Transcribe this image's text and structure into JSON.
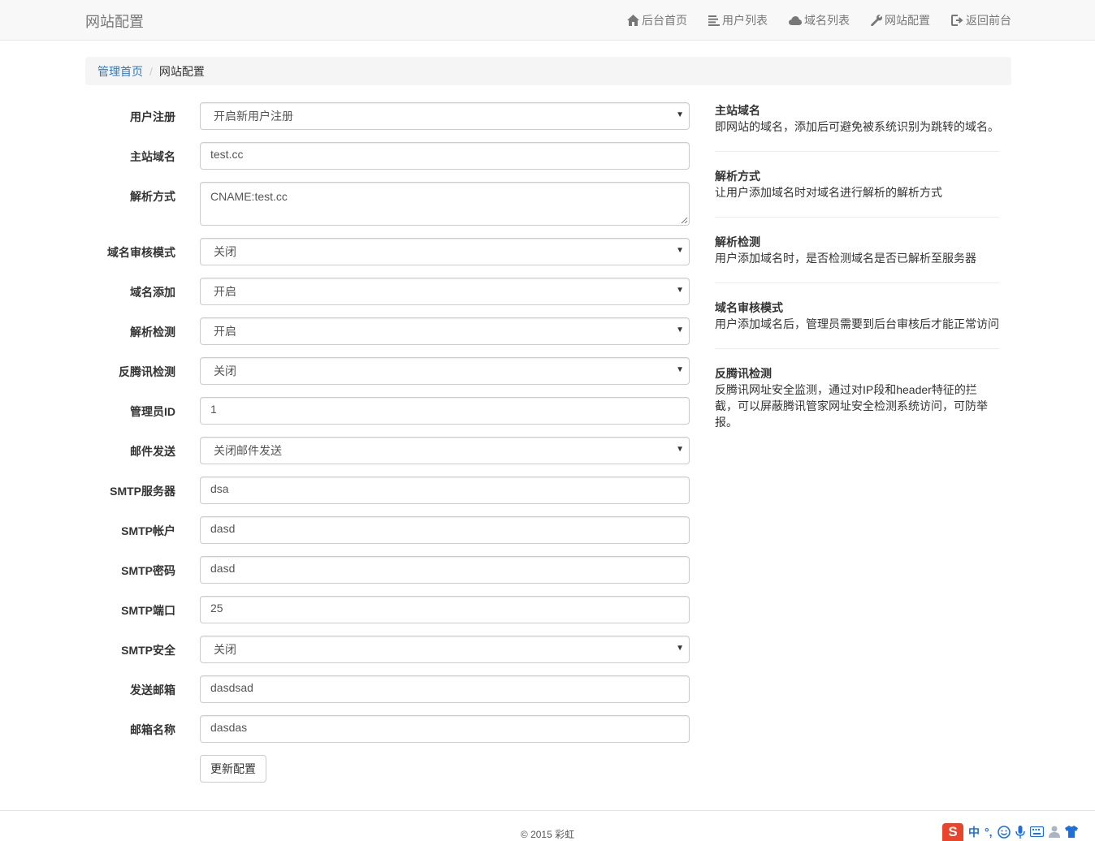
{
  "navbar": {
    "brand": "网站配置",
    "items": [
      {
        "label": "后台首页",
        "icon": "home-icon"
      },
      {
        "label": "用户列表",
        "icon": "list-icon"
      },
      {
        "label": "域名列表",
        "icon": "cloud-icon"
      },
      {
        "label": "网站配置",
        "icon": "wrench-icon"
      },
      {
        "label": "返回前台",
        "icon": "logout-icon"
      }
    ]
  },
  "breadcrumb": {
    "home": "管理首页",
    "separator": "/",
    "current": "网站配置"
  },
  "form": {
    "user_register": {
      "label": "用户注册",
      "value": "开启新用户注册"
    },
    "main_domain": {
      "label": "主站域名",
      "value": "test.cc"
    },
    "resolve_method": {
      "label": "解析方式",
      "value": "CNAME:test.cc"
    },
    "domain_audit": {
      "label": "域名审核模式",
      "value": "关闭"
    },
    "domain_add": {
      "label": "域名添加",
      "value": "开启"
    },
    "resolve_check": {
      "label": "解析检测",
      "value": "开启"
    },
    "anti_tencent": {
      "label": "反腾讯检测",
      "value": "关闭"
    },
    "admin_id": {
      "label": "管理员ID",
      "value": "1"
    },
    "mail_send": {
      "label": "邮件发送",
      "value": "关闭邮件发送"
    },
    "smtp_server": {
      "label": "SMTP服务器",
      "value": "dsa"
    },
    "smtp_account": {
      "label": "SMTP帐户",
      "value": "dasd"
    },
    "smtp_password": {
      "label": "SMTP密码",
      "value": "dasd"
    },
    "smtp_port": {
      "label": "SMTP端口",
      "value": "25"
    },
    "smtp_secure": {
      "label": "SMTP安全",
      "value": "关闭"
    },
    "sender_email": {
      "label": "发送邮箱",
      "value": "dasdsad"
    },
    "mail_name": {
      "label": "邮箱名称",
      "value": "dasdas"
    },
    "submit_label": "更新配置"
  },
  "help": [
    {
      "title": "主站域名",
      "text": "即网站的域名，添加后可避免被系统识别为跳转的域名。"
    },
    {
      "title": "解析方式",
      "text": "让用户添加域名时对域名进行解析的解析方式"
    },
    {
      "title": "解析检测",
      "text": "用户添加域名时，是否检测域名是否已解析至服务器"
    },
    {
      "title": "域名审核模式",
      "text": "用户添加域名后，管理员需要到后台审核后才能正常访问"
    },
    {
      "title": "反腾讯检测",
      "text_line1": "反腾讯网址安全监测，通过对IP段和header特征的拦",
      "text_line2": "截，可以屏蔽腾讯管家网址安全检测系统访问，可防举",
      "text_line3": "报。"
    }
  ],
  "footer": {
    "text": "© 2015 彩虹"
  },
  "ime": {
    "logo": "S",
    "lang": "中",
    "punct": "°,"
  },
  "colors": {
    "link": "#337ab7",
    "navbar_bg": "#f8f8f8",
    "ime_logo": "#e8452c",
    "ime_icons": "#1e6fd9"
  }
}
